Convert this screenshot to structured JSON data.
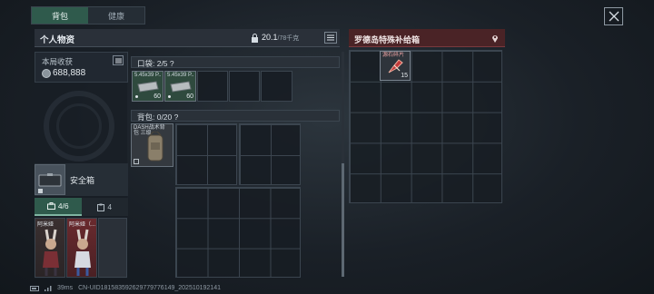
{
  "tabs": [
    {
      "label": "背包",
      "active": true
    },
    {
      "label": "健康",
      "active": false
    }
  ],
  "personal": {
    "title": "个人物资",
    "weight": "20.1",
    "weight_max": "/78千克"
  },
  "income": {
    "label": "本局收获",
    "value": "688,888"
  },
  "safe_box": {
    "label": "安全箱"
  },
  "equip_tabs": [
    {
      "count": "4/6",
      "icon": "briefcase-icon",
      "active": true
    },
    {
      "count": "4",
      "icon": "clipboard-icon",
      "active": false
    }
  ],
  "characters": [
    {
      "name": "阿米娅"
    },
    {
      "name": "阿米娅（..."
    }
  ],
  "pocket": {
    "label": "口袋: 2/5 ?",
    "items": [
      {
        "name": "5.45x39 P..",
        "count": "60"
      },
      {
        "name": "5.45x39 P..",
        "count": "60"
      }
    ]
  },
  "backpack": {
    "label": "背包: 0/20 ?",
    "item": {
      "name": "DASH战术背包 三级"
    }
  },
  "supply_box": {
    "title": "罗德岛特殊补给箱",
    "item": {
      "name": "源石碎片",
      "count": "15"
    }
  },
  "footer": {
    "ping": "39ms",
    "uid": "CN-UID181583592629779776149_20251019214​1"
  },
  "colors": {
    "accent_green": "#2f5a4c",
    "supply_red": "#4a2326"
  }
}
